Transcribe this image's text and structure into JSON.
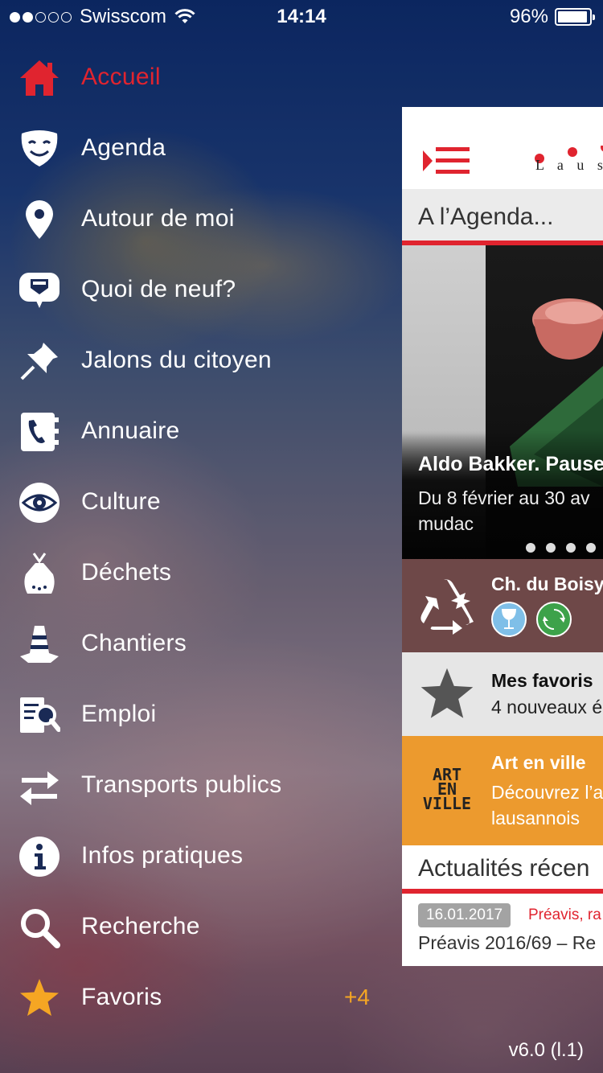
{
  "status_bar": {
    "carrier": "Swisscom",
    "time": "14:14",
    "battery": "96%",
    "battery_level": 0.96
  },
  "menu": {
    "items": [
      {
        "label": "Accueil",
        "icon": "home-icon",
        "active": true
      },
      {
        "label": "Agenda",
        "icon": "theater-mask-icon"
      },
      {
        "label": "Autour de moi",
        "icon": "map-pin-icon"
      },
      {
        "label": "Quoi de neuf?",
        "icon": "news-bubble-icon"
      },
      {
        "label": "Jalons du citoyen",
        "icon": "pushpin-icon"
      },
      {
        "label": "Annuaire",
        "icon": "phonebook-icon"
      },
      {
        "label": "Culture",
        "icon": "eye-icon"
      },
      {
        "label": "Déchets",
        "icon": "trash-bag-icon"
      },
      {
        "label": "Chantiers",
        "icon": "traffic-cone-icon"
      },
      {
        "label": "Emploi",
        "icon": "job-search-icon"
      },
      {
        "label": "Transports publics",
        "icon": "transfer-arrows-icon"
      },
      {
        "label": "Infos pratiques",
        "icon": "info-icon"
      },
      {
        "label": "Recherche",
        "icon": "search-icon"
      },
      {
        "label": "Favoris",
        "icon": "star-icon",
        "badge": "+4"
      }
    ]
  },
  "version": "v6.0 (l.1)",
  "panel": {
    "logo_text": "L a u s",
    "agenda_title": "A l’Agenda...",
    "hero": {
      "title": "Aldo Bakker. Pause",
      "subtitle": "Du 8 février au 30 av",
      "venue": "mudac",
      "page_count": 4
    },
    "recycle_card": {
      "title": "Ch. du Boisy"
    },
    "favorites_card": {
      "title": "Mes favoris",
      "text": "4 nouveaux é"
    },
    "art_card": {
      "title": "Art en ville",
      "line1": "Découvrez l’a",
      "line2": "lausannois",
      "logo_line1": "ART",
      "logo_line2": "EN",
      "logo_line3": "VILLE"
    },
    "news_title": "Actualités récen",
    "news": {
      "date": "16.01.2017",
      "category": "Préavis, ra",
      "text": "Préavis 2016/69 – Re"
    }
  },
  "colors": {
    "accent_red": "#e0242f",
    "badge_orange": "#f5a623",
    "recycle_bg": "#6e4848",
    "art_bg": "#ec9a2e"
  }
}
